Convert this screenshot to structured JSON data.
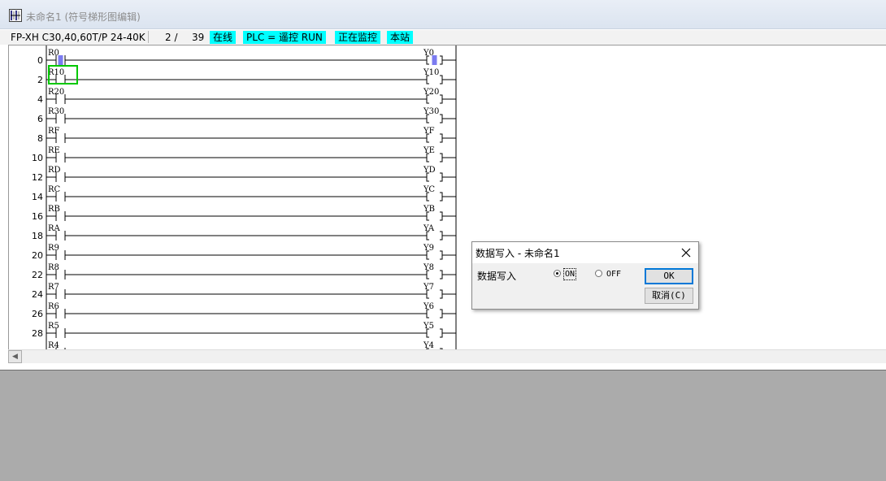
{
  "window": {
    "title": "未命名1 (符号梯形图编辑)"
  },
  "statusbar": {
    "model": "FP-XH C30,40,60T/P 24-40K",
    "step_position": "2 /",
    "step_total": "39",
    "online": "在线",
    "plc_mode": "PLC =  遥控 RUN",
    "monitoring": "正在监控",
    "station": "本站"
  },
  "ladder": {
    "rows": [
      {
        "step": "0",
        "contact": "R0",
        "coil": "Y0",
        "active": true
      },
      {
        "step": "2",
        "contact": "R10",
        "coil": "Y10",
        "active": false
      },
      {
        "step": "4",
        "contact": "R20",
        "coil": "Y20",
        "active": false
      },
      {
        "step": "6",
        "contact": "R30",
        "coil": "Y30",
        "active": false
      },
      {
        "step": "8",
        "contact": "RF",
        "coil": "YF",
        "active": false
      },
      {
        "step": "10",
        "contact": "RE",
        "coil": "YE",
        "active": false
      },
      {
        "step": "12",
        "contact": "RD",
        "coil": "YD",
        "active": false
      },
      {
        "step": "14",
        "contact": "RC",
        "coil": "YC",
        "active": false
      },
      {
        "step": "16",
        "contact": "RB",
        "coil": "YB",
        "active": false
      },
      {
        "step": "18",
        "contact": "RA",
        "coil": "YA",
        "active": false
      },
      {
        "step": "20",
        "contact": "R9",
        "coil": "Y9",
        "active": false
      },
      {
        "step": "22",
        "contact": "R8",
        "coil": "Y8",
        "active": false
      },
      {
        "step": "24",
        "contact": "R7",
        "coil": "Y7",
        "active": false
      },
      {
        "step": "26",
        "contact": "R6",
        "coil": "Y6",
        "active": false
      },
      {
        "step": "28",
        "contact": "R5",
        "coil": "Y5",
        "active": false
      },
      {
        "step": "",
        "contact": "R4",
        "coil": "Y4",
        "active": false
      }
    ],
    "colors": {
      "active": "#7b7bf0",
      "cursor": "#00c800"
    }
  },
  "dialog": {
    "title": "数据写入 - 未命名1",
    "label": "数据写入",
    "on_label": "ON",
    "off_label": "OFF",
    "ok_label": "OK",
    "cancel_label": "取消(C)",
    "selected": "ON"
  }
}
